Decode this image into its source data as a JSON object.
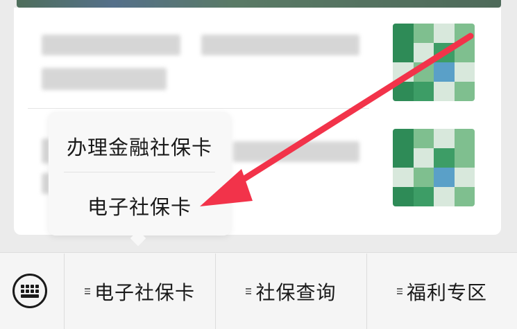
{
  "popup": {
    "items": [
      {
        "label": "办理金融社保卡"
      },
      {
        "label": "电子社保卡"
      }
    ]
  },
  "menu_bar": {
    "keyboard_icon": "keyboard-icon",
    "items": [
      {
        "label": "电子社保卡",
        "icon": "menu-lines-icon"
      },
      {
        "label": "社保查询",
        "icon": "menu-lines-icon"
      },
      {
        "label": "福利专区",
        "icon": "menu-lines-icon"
      }
    ]
  },
  "colors": {
    "arrow": "#f2334a",
    "card_bg": "#ffffff",
    "page_bg": "#ebebeb",
    "popup_bg": "#f8f8f8"
  }
}
